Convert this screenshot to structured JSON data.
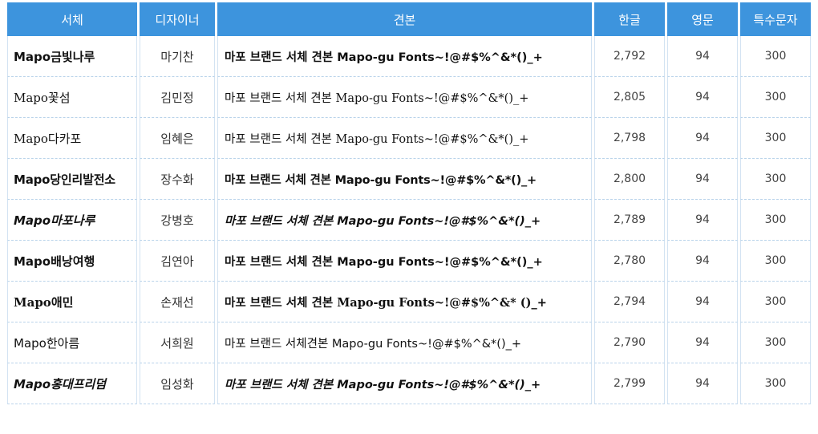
{
  "table": {
    "headers": {
      "font": "서체",
      "designer": "디자이너",
      "sample": "견본",
      "korean": "한글",
      "english": "영문",
      "special": "특수문자"
    },
    "rows": [
      {
        "font": "Mapo금빛나루",
        "designer": "마기찬",
        "sample": "마포 브랜드 서체 견본 Mapo-gu Fonts~!@#$%^&*()_+",
        "korean": "2,792",
        "english": "94",
        "special": "300"
      },
      {
        "font": "Mapo꽃섬",
        "designer": "김민정",
        "sample": "마포 브랜드 서체 견본 Mapo-gu Fonts~!@#$%^&*()_+",
        "korean": "2,805",
        "english": "94",
        "special": "300"
      },
      {
        "font": "Mapo다카포",
        "designer": "임혜은",
        "sample": "마포 브랜드 서체 견본 Mapo-gu Fonts~!@#$%^&*()_+",
        "korean": "2,798",
        "english": "94",
        "special": "300"
      },
      {
        "font": "Mapo당인리발전소",
        "designer": "장수화",
        "sample": "마포 브랜드 서체 견본 Mapo-gu Fonts~!@#$%^&*()_+",
        "korean": "2,800",
        "english": "94",
        "special": "300"
      },
      {
        "font": "Mapo마포나루",
        "designer": "강병호",
        "sample": "마포 브랜드 서체 견본 Mapo-gu Fonts~!@#$%^&*()_+",
        "korean": "2,789",
        "english": "94",
        "special": "300"
      },
      {
        "font": "Mapo배낭여행",
        "designer": "김연아",
        "sample": "마포 브랜드 서체 견본 Mapo-gu Fonts~!@#$%^&*()_+",
        "korean": "2,780",
        "english": "94",
        "special": "300"
      },
      {
        "font": "Mapo애민",
        "designer": "손재선",
        "sample": "마포 브랜드 서체 견본 Mapo-gu Fonts~!@#$%^&* ()_+",
        "korean": "2,794",
        "english": "94",
        "special": "300"
      },
      {
        "font": "Mapo한아름",
        "designer": "서희원",
        "sample": "마포 브랜드 서체견본 Mapo-gu Fonts~!@#$%^&*()_+",
        "korean": "2,790",
        "english": "94",
        "special": "300"
      },
      {
        "font": "Mapo홍대프리덤",
        "designer": "임성화",
        "sample": "마포 브랜드 서체 견본 Mapo-gu Fonts~!@#$%^&*()_+",
        "korean": "2,799",
        "english": "94",
        "special": "300"
      }
    ]
  },
  "colors": {
    "header_bg": "#3d94dd",
    "header_text": "#ffffff",
    "row_divider": "#b9d3ea"
  }
}
